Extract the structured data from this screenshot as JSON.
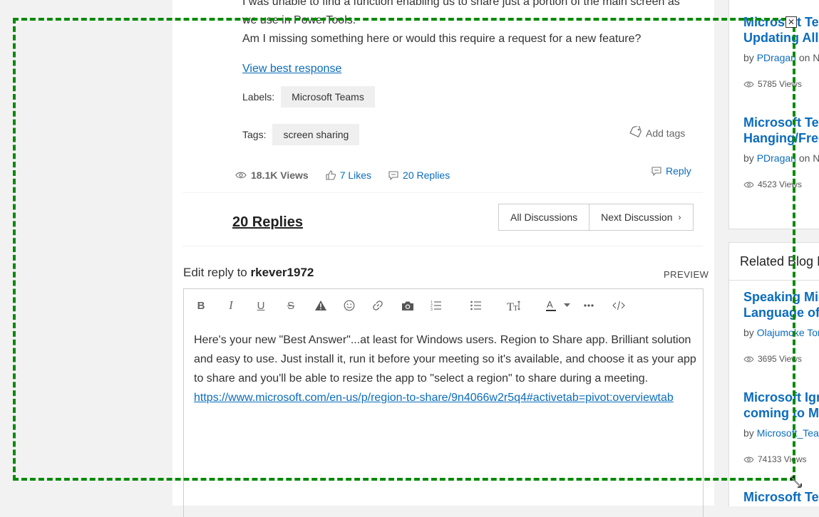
{
  "post": {
    "text_line_1": "I was unable to find a function enabling us to share just a portion of the main screen as",
    "text_line_2": "we use in PowerTools.",
    "text_line_3": "Am I missing something here or would this require a request for a new feature?",
    "view_best_response": "View best response",
    "labels_label": "Labels:",
    "label_chip": "Microsoft Teams",
    "tags_label": "Tags:",
    "tag_chip": "screen sharing",
    "add_tags": "Add tags",
    "views": "18.1K Views",
    "likes": "7 Likes",
    "replies": "20 Replies",
    "reply": "Reply"
  },
  "replies_section": {
    "heading": "20 Replies",
    "all_discussions": "All Discussions",
    "next_discussion": "Next Discussion"
  },
  "editor": {
    "heading_prefix": "Edit reply to",
    "heading_user": "rkever1972",
    "preview": "PREVIEW",
    "body": "Here's your new \"Best Answer\"...at least for Windows users. Region to Share app. Brilliant solution and easy to use. Just install it, run it before your meeting so it's available, and choose it as your app to share and you'll be able to resize the app to \"select a region\" to share during a meeting.",
    "link": "https://www.microsoft.com/en-us/p/region-to-share/9n4066w2r5q4#activetab=pivot:overviewtab"
  },
  "sidebar_top": {
    "items": [
      {
        "title_1": "Microsoft Tea",
        "title_2": "Updating All",
        "by": "by",
        "author": "PDragan",
        "on": "on N",
        "views": "5785 Views"
      },
      {
        "title_1": "Microsoft Tea",
        "title_2": "Hanging/Free",
        "by": "by",
        "author": "PDragan",
        "on": "on N",
        "views": "4523 Views"
      }
    ]
  },
  "sidebar_bottom": {
    "heading": "Related Blog P",
    "items": [
      {
        "title_1": "Speaking Mic",
        "title_2": "Language of",
        "by": "by",
        "author": "Olajumoke Tor",
        "views": "3695 Views"
      },
      {
        "title_1": "Microsoft Igni",
        "title_2": "coming to Mi",
        "by": "by",
        "author": "Microsoft_Tear",
        "views": "74133 Views"
      },
      {
        "title_1": "Microsoft Tea"
      }
    ]
  },
  "selection": {
    "close_glyph": "✕"
  },
  "colors": {
    "link": "#0b6cbd",
    "selection_border": "#0a8a0a"
  }
}
